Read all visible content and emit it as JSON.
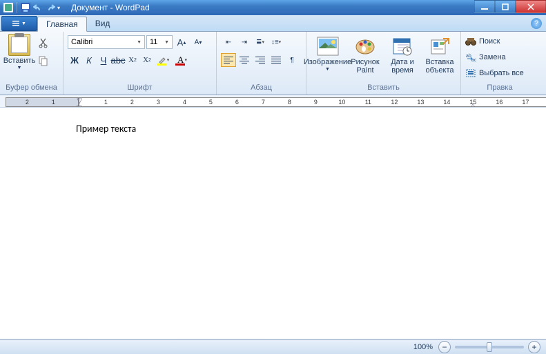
{
  "title": "Документ - WordPad",
  "tabs": {
    "main": "Главная",
    "view": "Вид"
  },
  "groups": {
    "clipboard": "Буфер обмена",
    "font": "Шрифт",
    "paragraph": "Абзац",
    "insert": "Вставить",
    "editing": "Правка"
  },
  "clipboard": {
    "paste": "Вставить"
  },
  "font": {
    "name": "Calibri",
    "size": "11"
  },
  "insert": {
    "image": "Изображение",
    "paint": "Рисунок\nPaint",
    "datetime": "Дата и\nвремя",
    "object": "Вставка\nобъекта"
  },
  "editing": {
    "find": "Поиск",
    "replace": "Замена",
    "selectall": "Выбрать все"
  },
  "ruler": {
    "left_numbers": [
      2,
      1
    ],
    "right_numbers": [
      1,
      2,
      3,
      4,
      5,
      6,
      7,
      8,
      9,
      10,
      11,
      12,
      13,
      14,
      15,
      16,
      17
    ]
  },
  "document": {
    "text": "Пример текста"
  },
  "status": {
    "zoom": "100%"
  }
}
